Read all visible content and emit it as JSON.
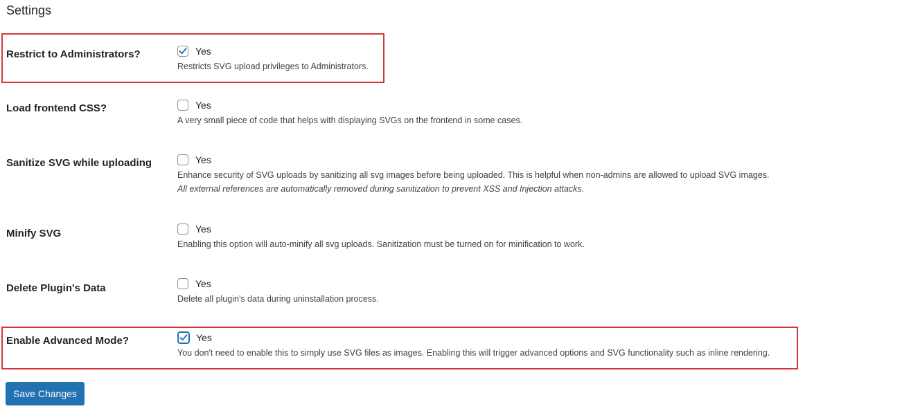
{
  "page": {
    "title": "Settings"
  },
  "settings": [
    {
      "label": "Restrict to Administrators?",
      "checkbox_label": "Yes",
      "checked": true,
      "description": "Restricts SVG upload privileges to Administrators.",
      "note": null,
      "highlighted": true
    },
    {
      "label": "Load frontend CSS?",
      "checkbox_label": "Yes",
      "checked": false,
      "description": "A very small piece of code that helps with displaying SVGs on the frontend in some cases.",
      "note": null,
      "highlighted": false
    },
    {
      "label": "Sanitize SVG while uploading",
      "checkbox_label": "Yes",
      "checked": false,
      "description": "Enhance security of SVG uploads by sanitizing all svg images before being uploaded. This is helpful when non-admins are allowed to upload SVG images.",
      "note": "All external references are automatically removed during sanitization to prevent XSS and Injection attacks.",
      "highlighted": false
    },
    {
      "label": "Minify SVG",
      "checkbox_label": "Yes",
      "checked": false,
      "description": "Enabling this option will auto-minify all svg uploads. Sanitization must be turned on for minification to work.",
      "note": null,
      "highlighted": false
    },
    {
      "label": "Delete Plugin's Data",
      "checkbox_label": "Yes",
      "checked": false,
      "description": "Delete all plugin's data during uninstallation process.",
      "note": null,
      "highlighted": false
    },
    {
      "label": "Enable Advanced Mode?",
      "checkbox_label": "Yes",
      "checked": true,
      "description": "You don't need to enable this to simply use SVG files as images. Enabling this will trigger advanced options and SVG functionality such as inline rendering.",
      "note": null,
      "highlighted": true
    }
  ],
  "actions": {
    "save_label": "Save Changes"
  },
  "colors": {
    "accent": "#2271b1",
    "highlight": "#d63638",
    "check": "#3582c4"
  }
}
